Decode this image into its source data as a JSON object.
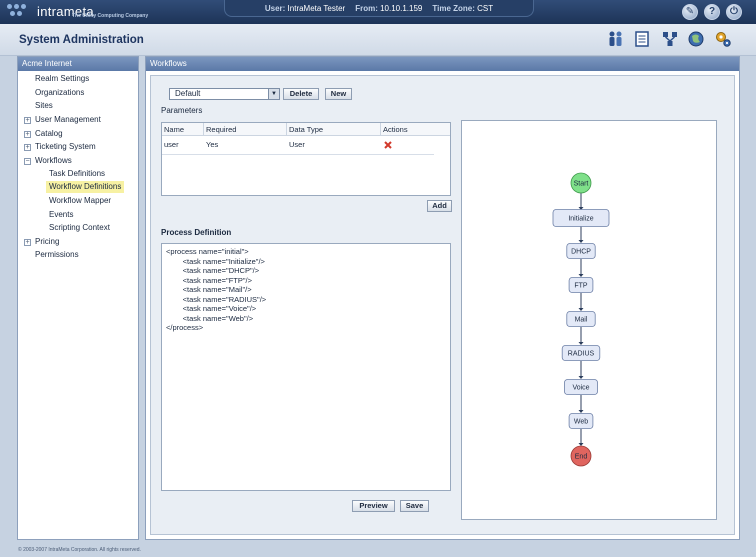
{
  "app": {
    "logo_text": "intrameta",
    "logo_tagline": "The Utility Computing Company",
    "user_label": "User:",
    "user_value": "IntraMeta Tester",
    "from_label": "From:",
    "from_value": "10.10.1.159",
    "timezone_label": "Time Zone:",
    "timezone_value": "CST",
    "top_icons": [
      "wrench-icon",
      "help-icon",
      "power-icon"
    ],
    "header_icons": [
      "users-icon",
      "catalog-icon",
      "network-icon",
      "globe-icon",
      "settings-icon"
    ]
  },
  "page": {
    "title": "System Administration"
  },
  "sidebar": {
    "header": "Acme Internet",
    "items": [
      {
        "label": "Realm Settings"
      },
      {
        "label": "Organizations"
      },
      {
        "label": "Sites"
      },
      {
        "label": "User Management",
        "toggle": "+"
      },
      {
        "label": "Catalog",
        "toggle": "+"
      },
      {
        "label": "Ticketing System",
        "toggle": "+"
      },
      {
        "label": "Workflows",
        "toggle": "−"
      },
      {
        "label": "Task Definitions"
      },
      {
        "label": "Workflow Definitions"
      },
      {
        "label": "Workflow Mapper"
      },
      {
        "label": "Events"
      },
      {
        "label": "Scripting Context"
      },
      {
        "label": "Pricing",
        "toggle": "+"
      },
      {
        "label": "Permissions"
      }
    ]
  },
  "main": {
    "panel_title": "Workflows",
    "select_value": "Default",
    "delete_label": "Delete",
    "new_label": "New",
    "parameters_label": "Parameters",
    "columns": [
      "Name",
      "Required",
      "Data Type",
      "Actions"
    ],
    "rows": [
      {
        "name": "user",
        "required": "Yes",
        "data_type": "User"
      }
    ],
    "add_label": "Add",
    "process_label": "Process Definition",
    "process_text": "<process name=\"initial\">\n        <task name=\"Initialize\"/>\n        <task name=\"DHCP\"/>\n        <task name=\"FTP\"/>\n        <task name=\"Mail\"/>\n        <task name=\"RADIUS\"/>\n        <task name=\"Voice\"/>\n        <task name=\"Web\"/>\n</process>",
    "preview_label": "Preview",
    "save_label": "Save"
  },
  "diagram": {
    "start": "Start",
    "end": "End",
    "tasks": [
      "Initialize",
      "DHCP",
      "FTP",
      "Mail",
      "RADIUS",
      "Voice",
      "Web"
    ],
    "colors": {
      "start": "#7fe08a",
      "end": "#e0655f",
      "task": "#e3e9f7"
    }
  },
  "footer": {
    "text": "© 2003-2007 IntraMeta Corporation. All rights reserved."
  }
}
